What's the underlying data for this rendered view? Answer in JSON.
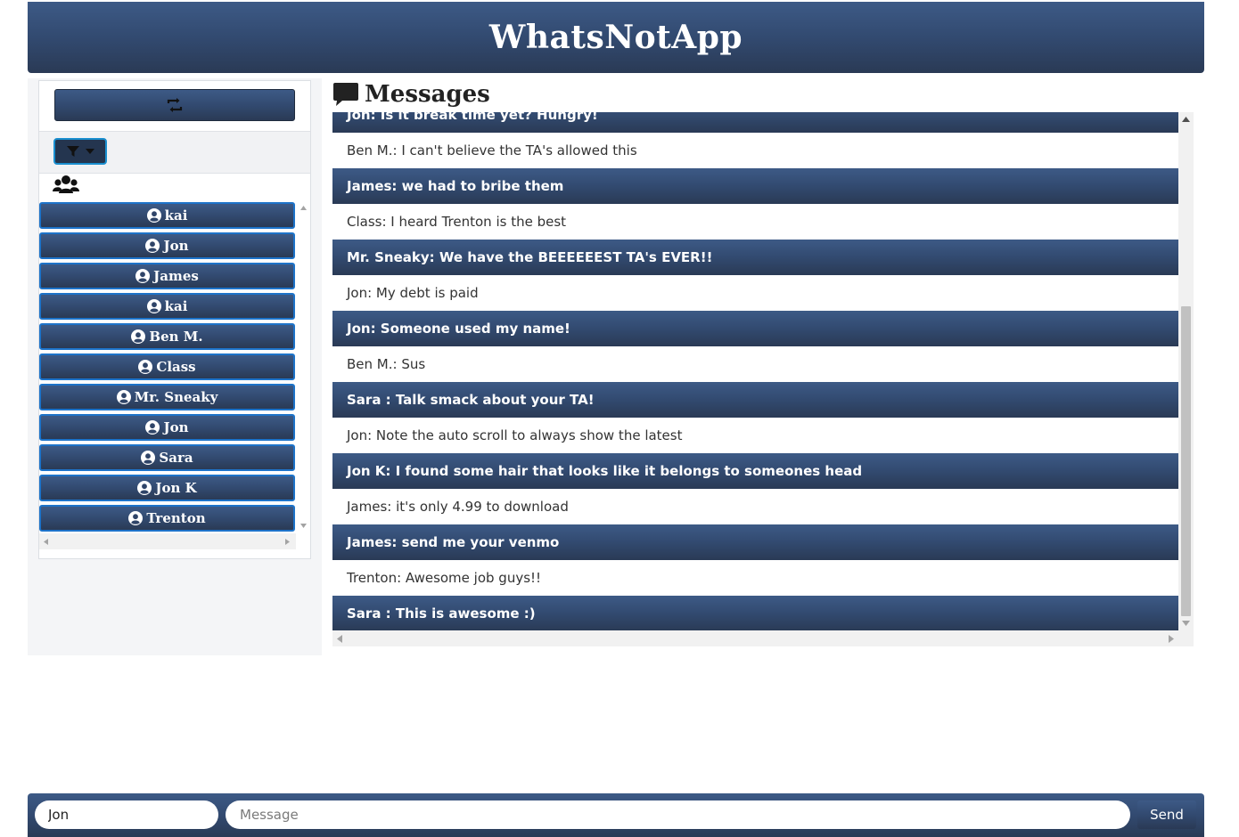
{
  "app": {
    "title": "WhatsNotApp"
  },
  "colors": {
    "header_gradient_top": "#3d5a86",
    "header_gradient_bottom": "#2a3a55",
    "user_button_border": "#1d73c9",
    "filter_border": "#1a8fcf"
  },
  "sidebar": {
    "refresh_icon": "retweet-icon",
    "filter_icon": "filter-icon",
    "filter_caret_icon": "caret-down-icon",
    "group_icon": "users-icon",
    "user_icon": "user-circle-icon",
    "users": [
      "kai",
      "Jon",
      "James",
      "kai",
      "Ben M.",
      "Class",
      "Mr. Sneaky",
      "Jon",
      "Sara",
      "Jon K",
      "Trenton"
    ]
  },
  "messages": {
    "title": "Messages",
    "title_icon": "comment-icon",
    "items": [
      {
        "text": "Jon: Is it break time yet? Hungry!",
        "style": "dark"
      },
      {
        "text": "Ben M.: I can't believe the TA's allowed this",
        "style": "light"
      },
      {
        "text": "James: we had to bribe them",
        "style": "dark"
      },
      {
        "text": "Class: I heard Trenton is the best",
        "style": "light"
      },
      {
        "text": "Mr. Sneaky: We have the BEEEEEEST TA's EVER!!",
        "style": "dark"
      },
      {
        "text": "Jon: My debt is paid",
        "style": "light"
      },
      {
        "text": "Jon: Someone used my name!",
        "style": "dark"
      },
      {
        "text": "Ben M.: Sus",
        "style": "light"
      },
      {
        "text": "Sara : Talk smack about your TA!",
        "style": "dark"
      },
      {
        "text": "Jon: Note the auto scroll to always show the latest",
        "style": "light"
      },
      {
        "text": "Jon K: I found some hair that looks like it belongs to someones head",
        "style": "dark"
      },
      {
        "text": "James: it's only 4.99 to download",
        "style": "light"
      },
      {
        "text": "James: send me your venmo",
        "style": "dark"
      },
      {
        "text": "Trenton: Awesome job guys!!",
        "style": "light"
      },
      {
        "text": "Sara : This is awesome :)",
        "style": "dark"
      }
    ]
  },
  "composer": {
    "name_value": "Jon",
    "message_placeholder": "Message",
    "send_label": "Send"
  }
}
